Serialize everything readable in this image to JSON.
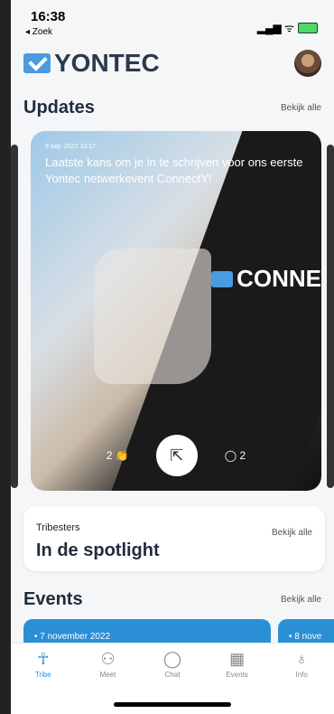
{
  "status": {
    "time": "16:38",
    "back": "◂ Zoek",
    "icons": "▂▄▆ ᯤ"
  },
  "header": {
    "logo": "YONTEC"
  },
  "updates": {
    "title": "Updates",
    "see_all": "Bekijk alle",
    "card": {
      "date": "9 sep. 2022 10:17",
      "title": "Laatste kans om je in te schrijven voor ons eerste Yontec netwerkevent ConnectY!",
      "brand": "CONNE",
      "likes": "2",
      "comments": "2"
    }
  },
  "spotlight": {
    "subtitle": "Tribesters",
    "title": "In de spotlight",
    "see_all": "Bekijk alle"
  },
  "events": {
    "title": "Events",
    "see_all": "Bekijk alle",
    "items": [
      {
        "date": "• 7 november 2022"
      },
      {
        "date": "• 8 nove"
      }
    ]
  },
  "tabs": [
    {
      "label": "Tribe",
      "icon": "tribe-icon"
    },
    {
      "label": "Meet",
      "icon": "people-icon"
    },
    {
      "label": "Chat",
      "icon": "chat-icon"
    },
    {
      "label": "Events",
      "icon": "calendar-icon"
    },
    {
      "label": "Info",
      "icon": "bulb-icon"
    }
  ],
  "colors": {
    "accent": "#2b8fd6",
    "title": "#1f2d3d"
  }
}
